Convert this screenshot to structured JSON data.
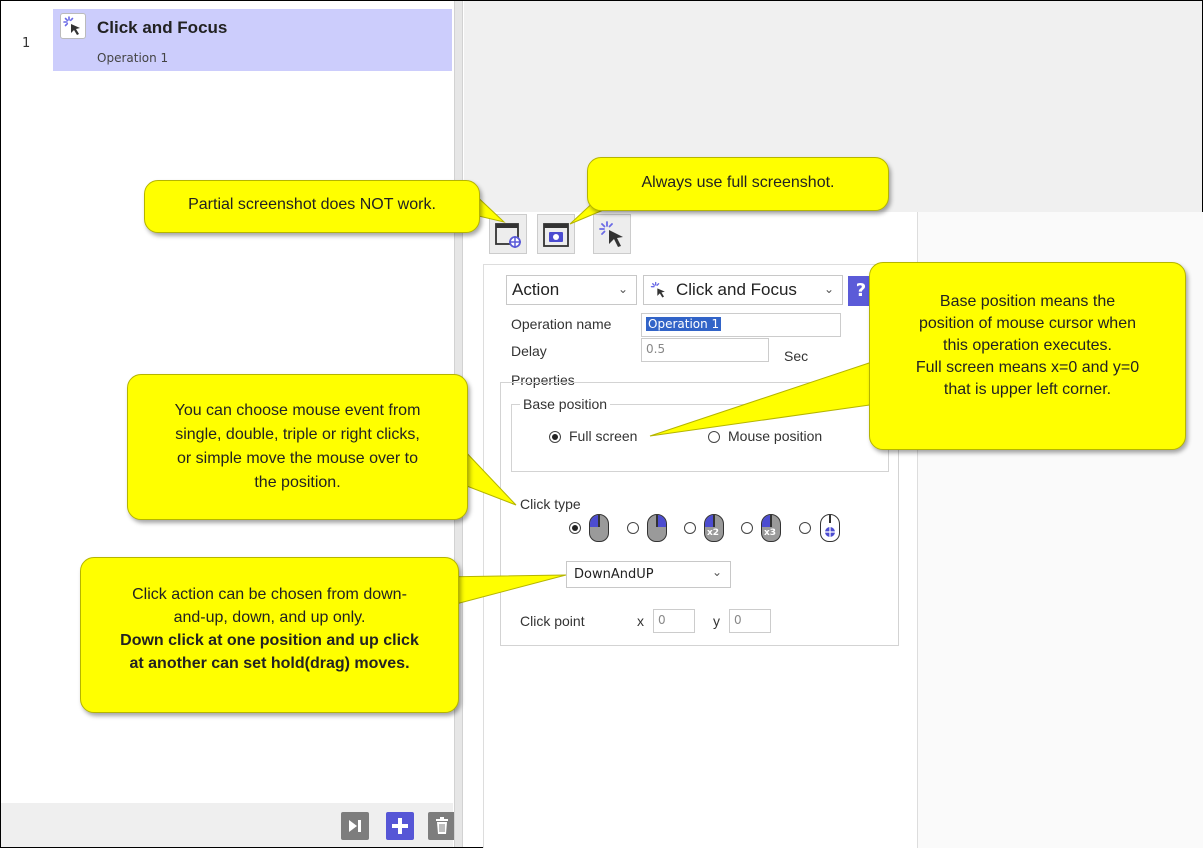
{
  "operations_list": {
    "items": [
      {
        "index": "1",
        "title": "Click and Focus",
        "subtitle": "Operation 1"
      }
    ]
  },
  "footer_buttons": [
    {
      "icon": "skip-to-end-icon"
    },
    {
      "icon": "plus-icon"
    },
    {
      "icon": "trash-icon"
    }
  ],
  "toolbar": {
    "buttons": [
      {
        "icon": "partial-screenshot-icon"
      },
      {
        "icon": "full-screenshot-icon"
      },
      {
        "icon": "click-focus-icon"
      }
    ]
  },
  "properties": {
    "category_select": "Action",
    "action_select": "Click and Focus",
    "help_label": "?",
    "operation_name_label": "Operation name",
    "operation_name_value": "Operation 1",
    "delay_label": "Delay",
    "delay_value": "0.5",
    "delay_unit": "Sec",
    "properties_group": "Properties",
    "base_position_group": "Base position",
    "full_screen_label": "Full screen",
    "mouse_position_label": "Mouse position",
    "click_type_label": "Click type",
    "click_action_select": "DownAndUP",
    "click_point_label": "Click point",
    "x_label": "x",
    "x_value": "0",
    "y_label": "y",
    "y_value": "0"
  },
  "click_types": [
    {
      "icon": "left-click-mouse-icon",
      "selected": true,
      "badge": ""
    },
    {
      "icon": "right-click-mouse-icon",
      "selected": false,
      "badge": ""
    },
    {
      "icon": "double-click-mouse-icon",
      "selected": false,
      "badge": "x2"
    },
    {
      "icon": "triple-click-mouse-icon",
      "selected": false,
      "badge": "x3"
    },
    {
      "icon": "mouse-move-icon",
      "selected": false,
      "badge": ""
    }
  ],
  "callouts": {
    "partial": "Partial screenshot does NOT work.",
    "full": "Always use full screenshot.",
    "base_position": [
      "Base position means the",
      "position of mouse cursor when",
      "this operation executes.",
      "Full screen means x=0 and y=0",
      "that is upper left corner."
    ],
    "click_type": [
      "You can choose mouse event from",
      "single, double, triple or right clicks,",
      "or simple move the mouse over to",
      "the position."
    ],
    "click_action": [
      "Click action can be chosen from down-",
      "and-up, down, and up only."
    ],
    "click_action_bold": [
      "Down click at one position and up click",
      "at another can set hold(drag) moves."
    ]
  }
}
